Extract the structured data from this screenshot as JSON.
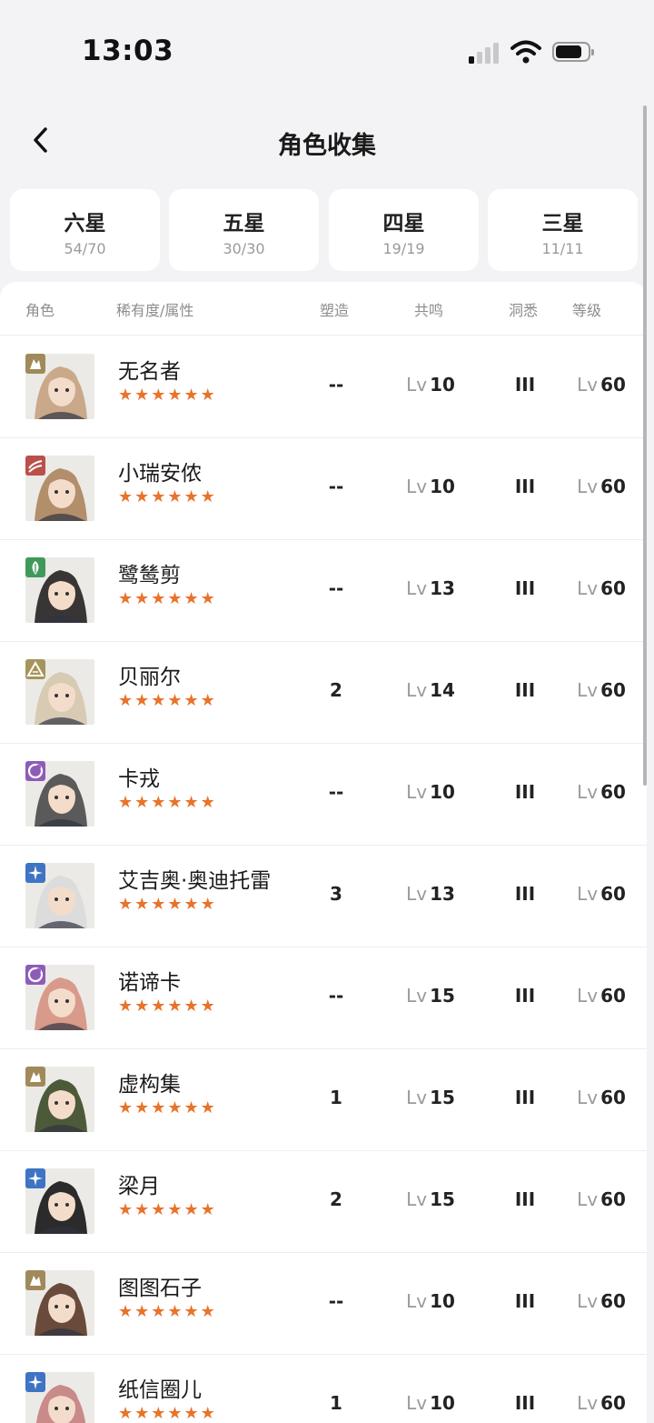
{
  "status": {
    "time": "13:03"
  },
  "header": {
    "title": "角色收集"
  },
  "tabs": [
    {
      "label": "六星",
      "count": "54/70"
    },
    {
      "label": "五星",
      "count": "30/30"
    },
    {
      "label": "四星",
      "count": "19/19"
    },
    {
      "label": "三星",
      "count": "11/11"
    }
  ],
  "table": {
    "headers": {
      "role": "角色",
      "rarity": "稀有度/属性",
      "shape": "塑造",
      "resonance": "共鸣",
      "insight": "洞悉",
      "level": "等级"
    },
    "lv_prefix": "Lv",
    "rows": [
      {
        "name": "无名者",
        "stars": "★★★★★★",
        "shape": "--",
        "resonance": "10",
        "insight": "III",
        "level": "60",
        "attribute": "beast-icon",
        "attr_color": "#a08a5a",
        "avatar": "#c9a98a"
      },
      {
        "name": "小瑞安侬",
        "stars": "★★★★★★",
        "shape": "--",
        "resonance": "10",
        "insight": "III",
        "level": "60",
        "attribute": "flame-icon",
        "attr_color": "#b9504a",
        "avatar": "#b38e6a"
      },
      {
        "name": "鹭鸶剪",
        "stars": "★★★★★★",
        "shape": "--",
        "resonance": "13",
        "insight": "III",
        "level": "60",
        "attribute": "leaf-icon",
        "attr_color": "#3f9a5a",
        "avatar": "#3a3535"
      },
      {
        "name": "贝丽尔",
        "stars": "★★★★★★",
        "shape": "2",
        "resonance": "14",
        "insight": "III",
        "level": "60",
        "attribute": "mountain-icon",
        "attr_color": "#a6955a",
        "avatar": "#d8cbb4"
      },
      {
        "name": "卡戎",
        "stars": "★★★★★★",
        "shape": "--",
        "resonance": "10",
        "insight": "III",
        "level": "60",
        "attribute": "moon-icon",
        "attr_color": "#8d5cb8",
        "avatar": "#5a5a5a"
      },
      {
        "name": "艾吉奥·奥迪托雷",
        "stars": "★★★★★★",
        "shape": "3",
        "resonance": "13",
        "insight": "III",
        "level": "60",
        "attribute": "star-icon",
        "attr_color": "#3f74c4",
        "avatar": "#dcdcdc"
      },
      {
        "name": "诺谛卡",
        "stars": "★★★★★★",
        "shape": "--",
        "resonance": "15",
        "insight": "III",
        "level": "60",
        "attribute": "moon-icon",
        "attr_color": "#8d5cb8",
        "avatar": "#d89a8a"
      },
      {
        "name": "虚构集",
        "stars": "★★★★★★",
        "shape": "1",
        "resonance": "15",
        "insight": "III",
        "level": "60",
        "attribute": "beast-icon",
        "attr_color": "#a08a5a",
        "avatar": "#4d5a3a"
      },
      {
        "name": "梁月",
        "stars": "★★★★★★",
        "shape": "2",
        "resonance": "15",
        "insight": "III",
        "level": "60",
        "attribute": "star-icon",
        "attr_color": "#3f74c4",
        "avatar": "#2b2b2b"
      },
      {
        "name": "图图石子",
        "stars": "★★★★★★",
        "shape": "--",
        "resonance": "10",
        "insight": "III",
        "level": "60",
        "attribute": "beast-icon",
        "attr_color": "#a08a5a",
        "avatar": "#6a4a3a"
      },
      {
        "name": "纸信圈儿",
        "stars": "★★★★★★",
        "shape": "1",
        "resonance": "10",
        "insight": "III",
        "level": "60",
        "attribute": "star-icon",
        "attr_color": "#3f74c4",
        "avatar": "#c98a8a"
      }
    ]
  }
}
